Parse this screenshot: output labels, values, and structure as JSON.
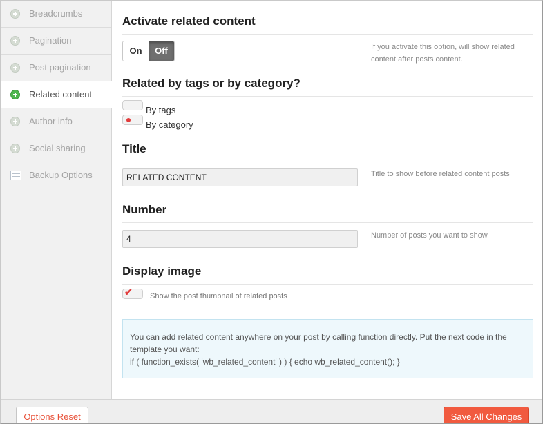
{
  "sidebar": {
    "items": [
      {
        "label": "Breadcrumbs",
        "icon": "plus-circle-icon",
        "active": false
      },
      {
        "label": "Pagination",
        "icon": "plus-circle-icon",
        "active": false
      },
      {
        "label": "Post pagination",
        "icon": "plus-circle-icon",
        "active": false
      },
      {
        "label": "Related content",
        "icon": "plus-circle-icon",
        "active": true
      },
      {
        "label": "Author info",
        "icon": "plus-circle-icon",
        "active": false
      },
      {
        "label": "Social sharing",
        "icon": "plus-circle-icon",
        "active": false
      },
      {
        "label": "Backup Options",
        "icon": "list-icon",
        "active": false
      }
    ]
  },
  "activate": {
    "title": "Activate related content",
    "on_label": "On",
    "off_label": "Off",
    "selected": "Off",
    "help": "If you activate this option, will show related content after posts content."
  },
  "related_by": {
    "title": "Related by tags or by category?",
    "options": [
      {
        "label": "By tags",
        "selected": false
      },
      {
        "label": "By category",
        "selected": true
      }
    ]
  },
  "title_field": {
    "title": "Title",
    "value": "RELATED CONTENT",
    "help": "Title to show before related content posts"
  },
  "number_field": {
    "title": "Number",
    "value": "4",
    "help": "Number of posts you want to show"
  },
  "display_image": {
    "title": "Display image",
    "checked": true,
    "label": "Show the post thumbnail of related posts"
  },
  "info": {
    "line1": "You can add related content anywhere on your post by calling function directly. Put the next code in the template you want:",
    "line2": "if ( function_exists( 'wb_related_content' ) ) { echo wb_related_content(); }"
  },
  "footer": {
    "reset_label": "Options Reset",
    "save_label": "Save All Changes"
  },
  "colors": {
    "accent": "#f15a3f",
    "active_icon": "#4fb64f",
    "info_bg": "#eef8fc"
  }
}
